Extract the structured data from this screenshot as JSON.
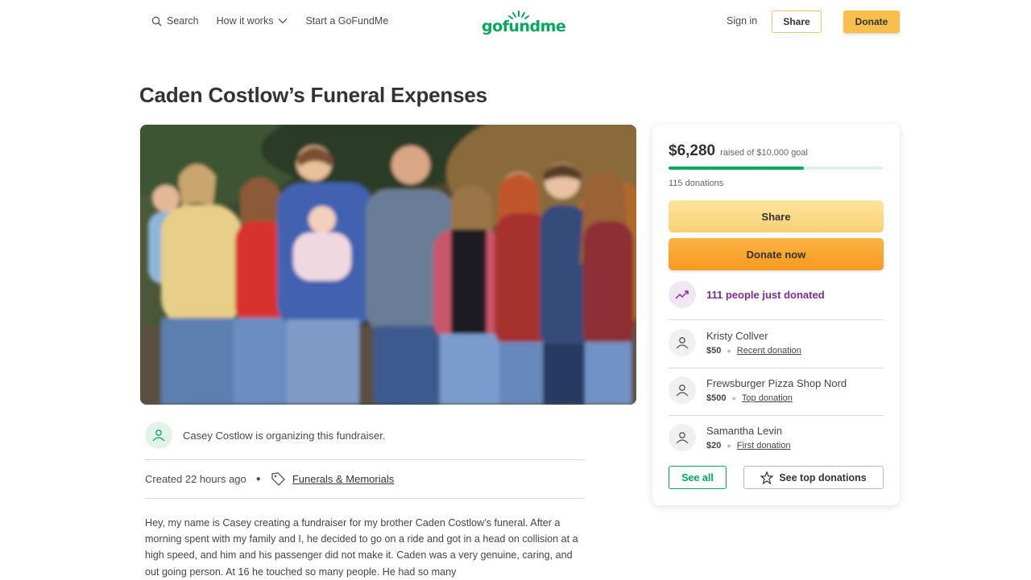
{
  "header": {
    "search_label": "Search",
    "how_it_works_label": "How it works",
    "start_label": "Start a GoFundMe",
    "logo_text": "gofundme",
    "sign_in_label": "Sign in",
    "share_label": "Share",
    "donate_label": "Donate"
  },
  "campaign": {
    "title": "Caden Costlow’s Funeral Expenses",
    "organizer_text": "Casey Costlow is organizing this fundraiser.",
    "created": "Created 22 hours ago",
    "category": "Funerals & Memorials",
    "story": "Hey, my name is Casey creating a fundraiser for my brother Caden Costlow’s funeral. After a morning spent with my family and I, he decided to go on a ride and got in a head on collision at a high speed, and him and his passenger did not make it. Caden was a very genuine, caring, and out going person. At 16 he touched so many people. He had so many"
  },
  "sidebar": {
    "raised_amount": "$6,280",
    "raised_sub": "raised of $10,000 goal",
    "progress_fraction": 0.628,
    "donation_count": "115 donations",
    "share_label": "Share",
    "donate_label": "Donate now",
    "trend_text": "111 people just donated",
    "donors": [
      {
        "name": "Kristy Collver",
        "amount": "$50",
        "tag": "Recent donation"
      },
      {
        "name": "Frewsburger Pizza Shop Nord",
        "amount": "$500",
        "tag": "Top donation"
      },
      {
        "name": "Samantha Levin",
        "amount": "$20",
        "tag": "First donation"
      }
    ],
    "see_all_label": "See all",
    "see_top_label": "See top donations"
  },
  "colors": {
    "brand_green": "#02a95c",
    "donate_orange": "#f69a1f",
    "share_yellow": "#f9cf75",
    "trend_purple": "#7a2d8f"
  },
  "icons": [
    "search-icon",
    "chevron-down-icon",
    "tag-icon",
    "heart-hand-icon",
    "trending-up-icon",
    "star-icon"
  ]
}
